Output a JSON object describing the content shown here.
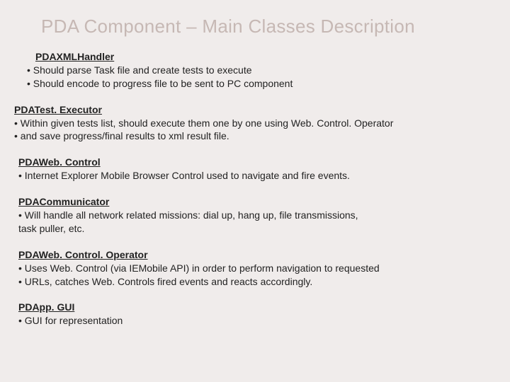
{
  "title": "PDA Component – Main Classes Description",
  "sections": [
    {
      "heading": "PDAXMLHandler",
      "heading_pad": "indent0",
      "lines": [
        " •  Should parse Task file and create tests to execute",
        " •  Should encode to progress file to be sent to PC component"
      ]
    },
    {
      "heading": "PDATest. Executor",
      "heading_pad": "indent2",
      "lines": [
        "• Within given tests list, should execute them one by one using Web. Control. Operator",
        "• and save progress/final results to xml result file."
      ]
    },
    {
      "heading": "PDAWeb. Control",
      "heading_pad": "indent3",
      "lines": [
        "• Internet Explorer Mobile Browser Control used to navigate and fire events."
      ]
    },
    {
      "heading": "PDACommunicator",
      "heading_pad": "indent4",
      "lines": [
        "• Will handle all network related missions: dial up, hang up, file transmissions,",
        "  task puller, etc."
      ]
    },
    {
      "heading": "PDAWeb. Control. Operator",
      "heading_pad": "indent4",
      "lines": [
        "• Uses Web. Control (via IEMobile API) in order to perform navigation to requested",
        "• URLs, catches Web. Controls fired events and reacts accordingly."
      ]
    },
    {
      "heading": "PDApp. GUI",
      "heading_pad": "indent4",
      "lines": [
        "• GUI for representation"
      ]
    }
  ]
}
